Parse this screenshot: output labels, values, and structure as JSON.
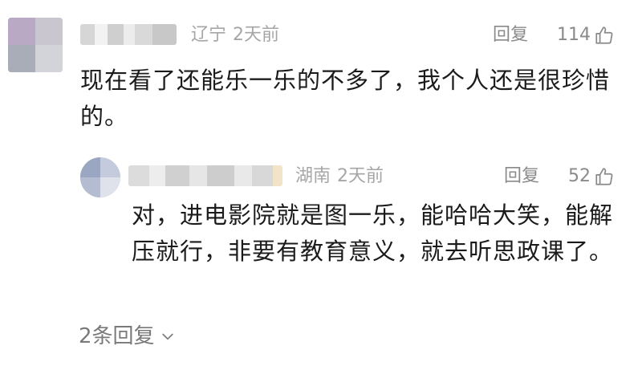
{
  "comments": [
    {
      "region": "辽宁",
      "time": "2天前",
      "reply_label": "回复",
      "likes": "114",
      "text": "现在看了还能乐一乐的不多了，我个人还是很珍惜的。",
      "icons": {
        "like": "thumbs-up-icon"
      }
    },
    {
      "region": "湖南",
      "time": "2天前",
      "reply_label": "回复",
      "likes": "52",
      "text": "对，进电影院就是图一乐，能哈哈大笑，能解压就行，非要有教育意义，就去听思政课了。",
      "icons": {
        "like": "thumbs-up-icon"
      }
    }
  ],
  "more_replies": {
    "label": "2条回复",
    "icon": "chevron-down-icon"
  }
}
